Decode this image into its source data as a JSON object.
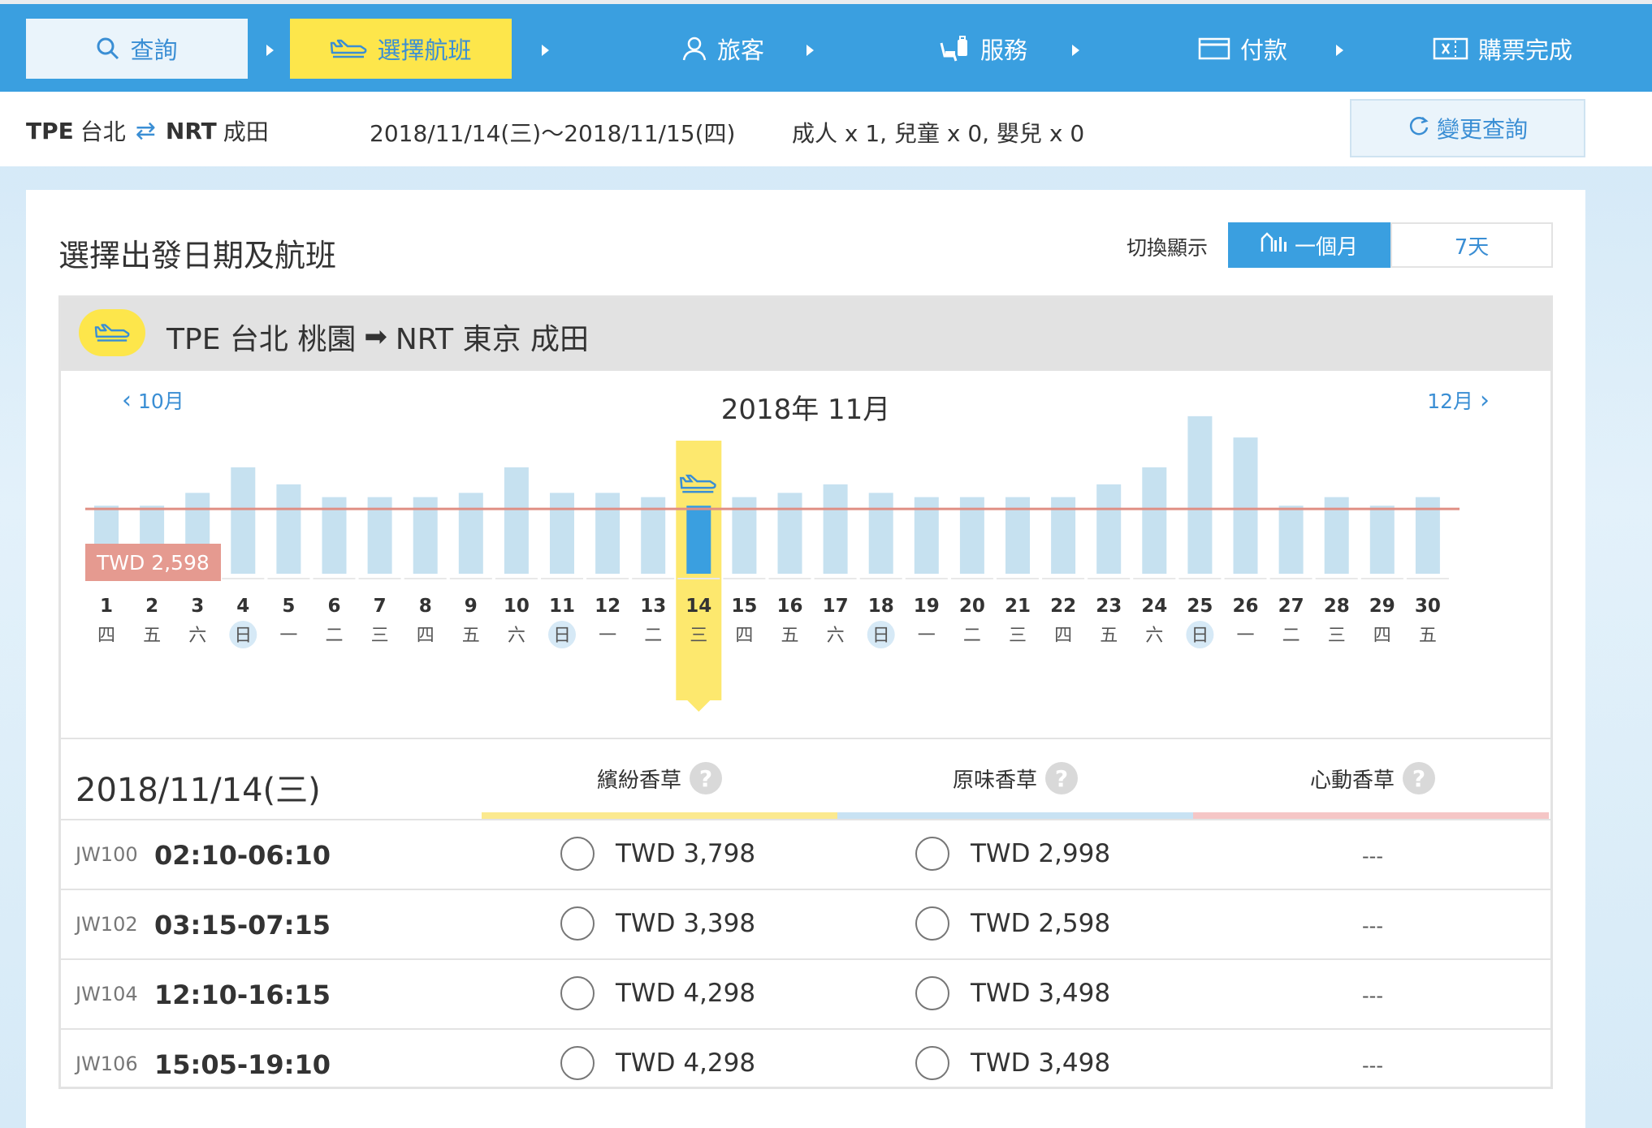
{
  "steps": [
    {
      "label": "查詢"
    },
    {
      "label": "選擇航班"
    },
    {
      "label": "旅客"
    },
    {
      "label": "服務"
    },
    {
      "label": "付款"
    },
    {
      "label": "購票完成"
    }
  ],
  "summary": {
    "origin_code": "TPE",
    "origin_name": "台北",
    "dest_code": "NRT",
    "dest_name": "成田",
    "dates": "2018/11/14(三)～2018/11/15(四)",
    "passengers": "成人 x 1,  兒童 x 0,  嬰兒 x 0",
    "change_button": "變更查詢"
  },
  "card": {
    "title": "選擇出發日期及航班",
    "switch_label": "切換顯示",
    "switch_month": "一個月",
    "switch_week": "7天"
  },
  "route": {
    "text_from": "TPE  台北 桃園",
    "text_to": "NRT  東京 成田"
  },
  "calendar": {
    "prev": "10月",
    "next": "12月",
    "title": "2018年 11月",
    "baseline_label": "TWD 2,598",
    "selected_day": 14,
    "days": [
      {
        "d": "1",
        "w": "四"
      },
      {
        "d": "2",
        "w": "五"
      },
      {
        "d": "3",
        "w": "六"
      },
      {
        "d": "4",
        "w": "日",
        "sun": true
      },
      {
        "d": "5",
        "w": "一"
      },
      {
        "d": "6",
        "w": "二"
      },
      {
        "d": "7",
        "w": "三"
      },
      {
        "d": "8",
        "w": "四"
      },
      {
        "d": "9",
        "w": "五"
      },
      {
        "d": "10",
        "w": "六"
      },
      {
        "d": "11",
        "w": "日",
        "sun": true
      },
      {
        "d": "12",
        "w": "一"
      },
      {
        "d": "13",
        "w": "二"
      },
      {
        "d": "14",
        "w": "三"
      },
      {
        "d": "15",
        "w": "四"
      },
      {
        "d": "16",
        "w": "五"
      },
      {
        "d": "17",
        "w": "六"
      },
      {
        "d": "18",
        "w": "日",
        "sun": true
      },
      {
        "d": "19",
        "w": "一"
      },
      {
        "d": "20",
        "w": "二"
      },
      {
        "d": "21",
        "w": "三"
      },
      {
        "d": "22",
        "w": "四"
      },
      {
        "d": "23",
        "w": "五"
      },
      {
        "d": "24",
        "w": "六"
      },
      {
        "d": "25",
        "w": "日",
        "sun": true
      },
      {
        "d": "26",
        "w": "一"
      },
      {
        "d": "27",
        "w": "二"
      },
      {
        "d": "28",
        "w": "三"
      },
      {
        "d": "29",
        "w": "四"
      },
      {
        "d": "30",
        "w": "五"
      }
    ]
  },
  "chart_data": {
    "type": "bar",
    "categories": [
      "1",
      "2",
      "3",
      "4",
      "5",
      "6",
      "7",
      "8",
      "9",
      "10",
      "11",
      "12",
      "13",
      "14",
      "15",
      "16",
      "17",
      "18",
      "19",
      "20",
      "21",
      "22",
      "23",
      "24",
      "25",
      "26",
      "27",
      "28",
      "29",
      "30"
    ],
    "values": [
      2598,
      2598,
      2898,
      3498,
      3098,
      2798,
      2798,
      2798,
      2898,
      3498,
      2898,
      2898,
      2798,
      2598,
      2798,
      2898,
      3098,
      2898,
      2798,
      2798,
      2798,
      2798,
      3098,
      3498,
      4698,
      4198,
      2598,
      2798,
      2598,
      2798
    ],
    "reference_line": 2598,
    "ylim": [
      1000,
      5000
    ]
  },
  "flights": {
    "date": "2018/11/14(三)",
    "fares": [
      {
        "name": "繽紛香草",
        "color": "#fbe98f"
      },
      {
        "name": "原味香草",
        "color": "#c8e2f3"
      },
      {
        "name": "心動香草",
        "color": "#f5c6c6"
      }
    ],
    "rows": [
      {
        "no": "JW100",
        "time": "02:10-06:10",
        "f1": "TWD 3,798",
        "f2": "TWD 2,998",
        "f3": "---"
      },
      {
        "no": "JW102",
        "time": "03:15-07:15",
        "f1": "TWD 3,398",
        "f2": "TWD 2,598",
        "f3": "---"
      },
      {
        "no": "JW104",
        "time": "12:10-16:15",
        "f1": "TWD 4,298",
        "f2": "TWD 3,498",
        "f3": "---"
      },
      {
        "no": "JW106",
        "time": "15:05-19:10",
        "f1": "TWD 4,298",
        "f2": "TWD 3,498",
        "f3": "---"
      }
    ]
  }
}
